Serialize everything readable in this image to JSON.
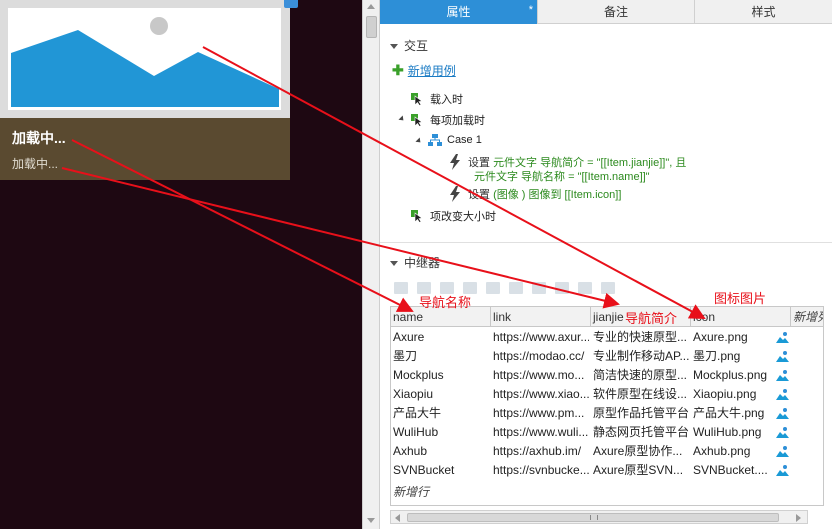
{
  "canvas": {
    "card_title": "加载中...",
    "card_subtitle": "加载中..."
  },
  "tabs": [
    {
      "label": "属性",
      "modified_mark": "*"
    },
    {
      "label": "备注"
    },
    {
      "label": "样式"
    }
  ],
  "interaction": {
    "section_title": "交互",
    "add_case_label": "新增用例",
    "events": {
      "on_load": "载入时",
      "on_item_load": "每项加载时",
      "case_name": "Case 1",
      "action1_line1_prefix": "设置 ",
      "action1_line1_green": "元件文字  导航简介 = \"[[Item.jianjie]]\", 且",
      "action1_line2_green": "元件文字  导航名称 = \"[[Item.name]]\"",
      "action2_prefix": "设置 ",
      "action2_green": "(图像 ) 图像到 [[Item.icon]]",
      "on_item_resize": "项改变大小时"
    }
  },
  "repeater": {
    "section_title": "中继器",
    "columns": [
      "name",
      "link",
      "jianjie",
      "icon",
      "新增列"
    ],
    "rows": [
      {
        "name": "Axure",
        "link": "https://www.axur...",
        "jianjie": "专业的快速原型...",
        "icon": "Axure.png"
      },
      {
        "name": "墨刀",
        "link": "https://modao.cc/",
        "jianjie": "专业制作移动AP...",
        "icon": "墨刀.png"
      },
      {
        "name": "Mockplus",
        "link": "https://www.mo...",
        "jianjie": "简洁快速的原型...",
        "icon": "Mockplus.png"
      },
      {
        "name": "Xiaopiu",
        "link": "https://www.xiao...",
        "jianjie": "软件原型在线设...",
        "icon": "Xiaopiu.png"
      },
      {
        "name": "产品大牛",
        "link": "https://www.pm...",
        "jianjie": "原型作品托管平台",
        "icon": "产品大牛.png"
      },
      {
        "name": "WuliHub",
        "link": "https://www.wuli...",
        "jianjie": "静态网页托管平台",
        "icon": "WuliHub.png"
      },
      {
        "name": "Axhub",
        "link": "https://axhub.im/",
        "jianjie": "Axure原型协作...",
        "icon": "Axhub.png"
      },
      {
        "name": "SVNBucket",
        "link": "https://svnbucke...",
        "jianjie": "Axure原型SVN...",
        "icon": "SVNBucket...."
      }
    ],
    "new_row_label": "新增行"
  },
  "annotations": {
    "label_name": "导航名称",
    "label_intro": "导航简介",
    "label_icon": "图标图片",
    "color": "#e8101a"
  },
  "colors": {
    "tab_active": "#2d8fd7",
    "link_blue": "#1a7bc4",
    "action_green": "#2c8a1e",
    "canvas_bg": "#1e0812",
    "caption_bg": "#5a4a30"
  }
}
